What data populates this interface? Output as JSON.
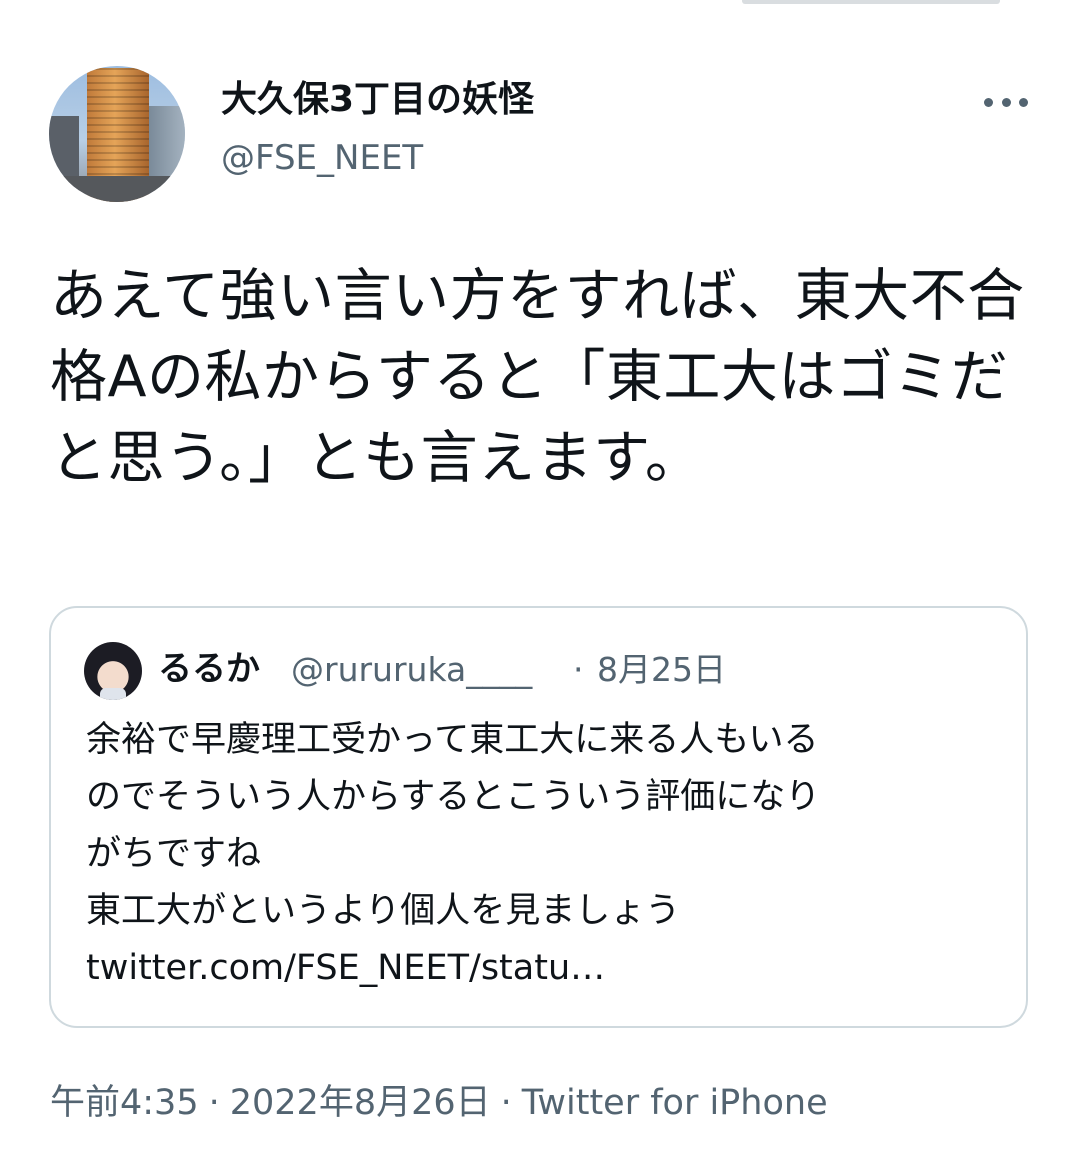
{
  "author": {
    "display_name": "大久保3丁目の妖怪",
    "username": "@FSE_NEET",
    "avatar_icon": "building-photo-avatar",
    "more_icon": "more-horizontal-icon"
  },
  "tweet": {
    "text": "あえて強い言い方をすれば、東大不合格Aの私からすると「東工大はゴミだと思う。」とも言えます。"
  },
  "quoted_tweet": {
    "display_name": "るるか",
    "username": "@rururuka____",
    "separator": "·",
    "date": "8月25日",
    "avatar_icon": "anime-girl-avatar",
    "lines": [
      "余裕で早慶理工受かって東工大に来る人もいる",
      "のでそういう人からするとこういう評価になり",
      "がちですね",
      "東工大がというより個人を見ましょう",
      "twitter.com/FSE_NEET/statu…"
    ]
  },
  "meta": {
    "time": "午前4:35",
    "separator": "·",
    "date": "2022年8月26日",
    "source": "Twitter for iPhone"
  },
  "colors": {
    "text": "#0f1419",
    "secondary": "#536471",
    "border": "#cfd9de"
  }
}
